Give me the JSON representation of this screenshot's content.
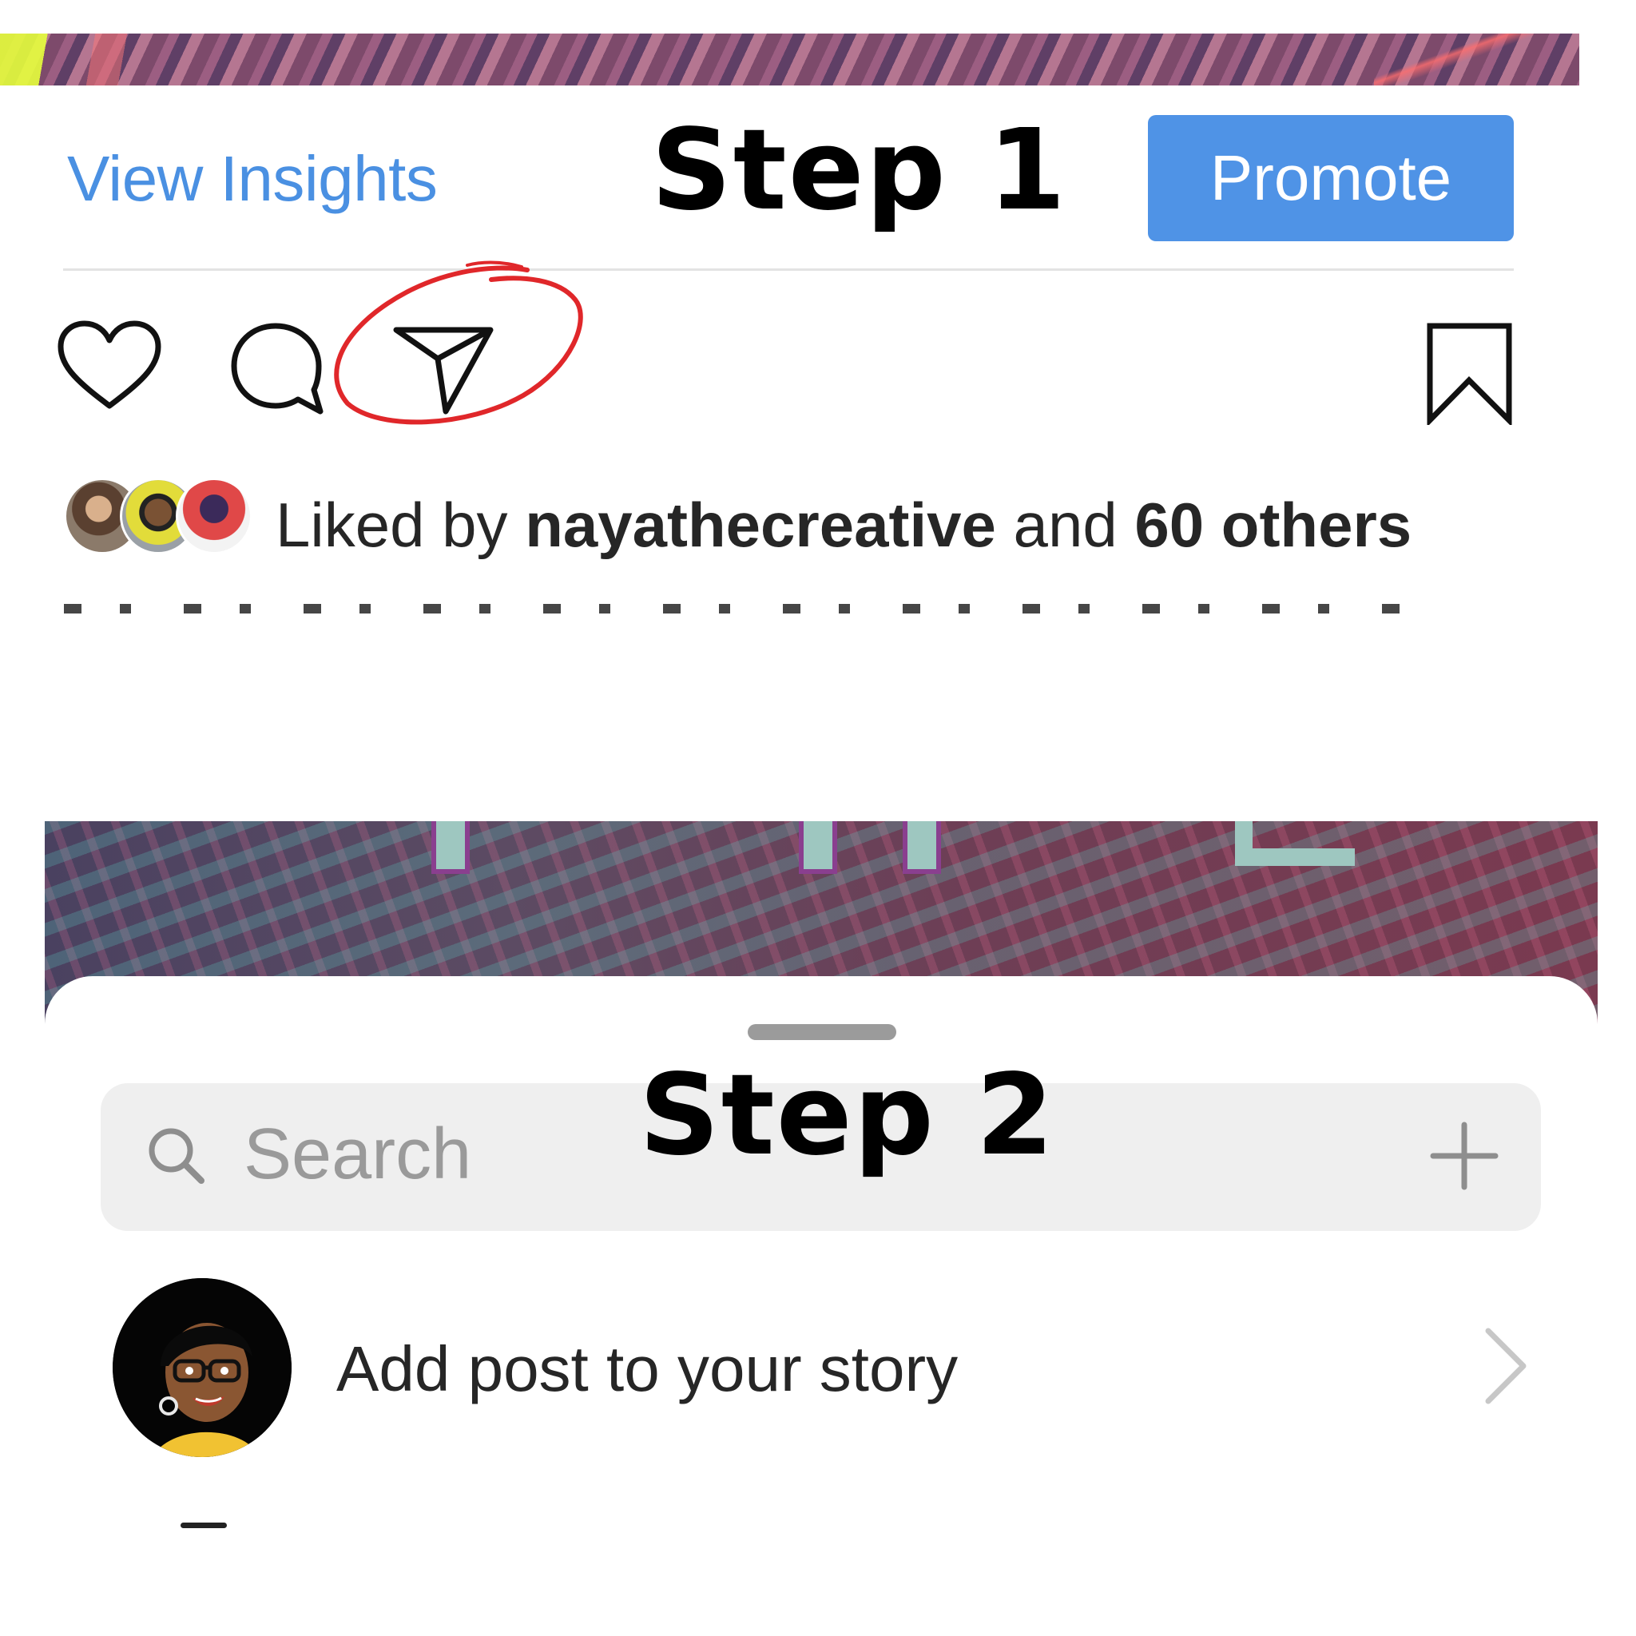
{
  "step1": {
    "label": "Step 1",
    "view_insights": "View Insights",
    "promote": "Promote",
    "likes": {
      "prefix": "Liked by ",
      "user": "nayathecreative",
      "middle": " and ",
      "count": "60 others"
    }
  },
  "step2": {
    "label": "Step 2",
    "search": {
      "placeholder": "Search"
    },
    "story_row": {
      "label": "Add post to your story"
    }
  },
  "colors": {
    "link_blue": "#4a90e2",
    "promote_bg": "#4f93e6",
    "annotation_red": "#e0272a"
  },
  "icons": [
    "heart-icon",
    "comment-icon",
    "send-icon",
    "bookmark-icon",
    "search-icon",
    "plus-icon",
    "chevron-right-icon"
  ]
}
